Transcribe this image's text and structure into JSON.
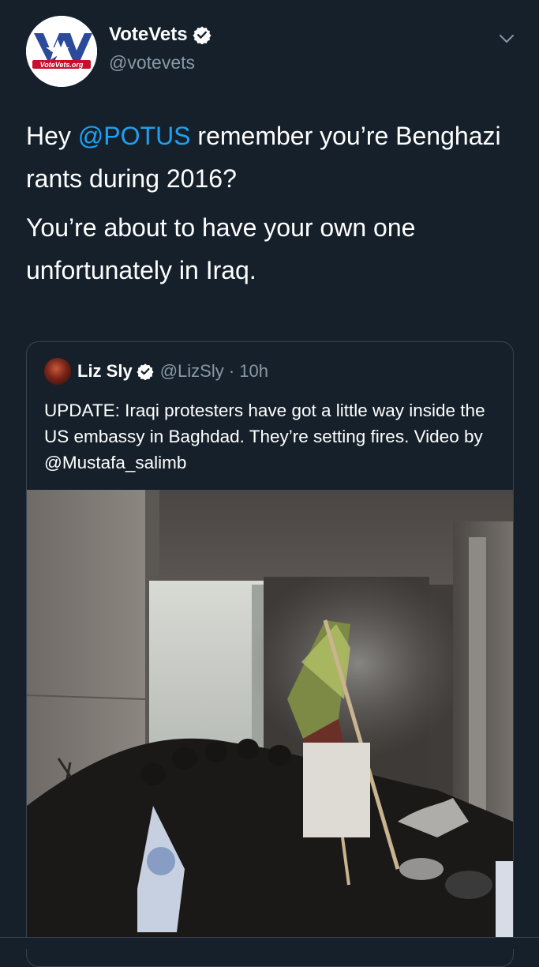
{
  "tweet": {
    "display_name": "VoteVets",
    "handle": "@votevets",
    "avatar_logo": "VoteVets.org",
    "text_p1_prefix": "Hey ",
    "text_p1_mention": "@POTUS",
    "text_p1_suffix": " remember you’re Benghazi rants during 2016?",
    "text_p2": "You’re about to have your own one unfortunately in Iraq."
  },
  "quoted": {
    "display_name": "Liz Sly",
    "handle_time": "@LizSly · 10h",
    "text": "UPDATE: Iraqi protesters have got a little way inside the US embassy in Baghdad. They’re setting fires. Video by @Mustafa_salimb"
  },
  "icons": {
    "verified": "verified-badge-icon",
    "caret": "chevron-down-icon"
  },
  "colors": {
    "background": "#15202b",
    "accent": "#1da1f2",
    "secondary_text": "#8899a6",
    "border": "#38444d"
  }
}
